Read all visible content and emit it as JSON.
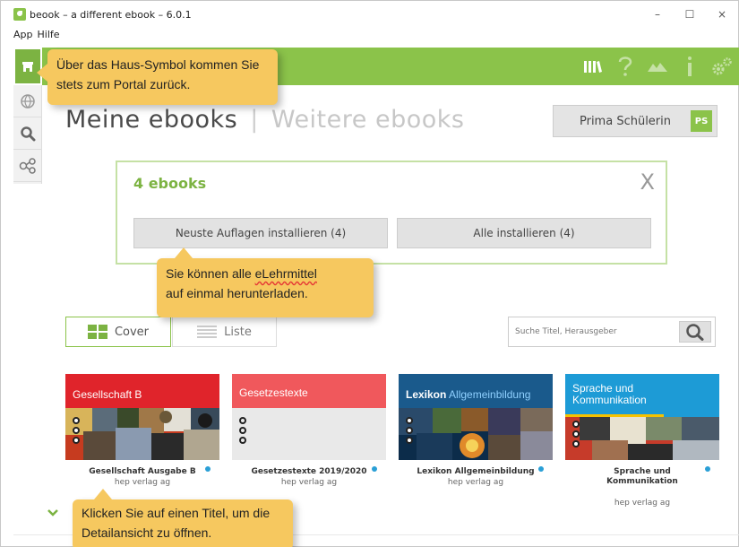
{
  "window": {
    "title": "beook – a different ebook – 6.0.1",
    "minimize": "–",
    "maximize": "☐",
    "close": "×"
  },
  "menu": [
    "App",
    "Hilfe"
  ],
  "tabs": {
    "active": "Meine ebooks",
    "separator": "|",
    "inactive": "Weitere ebooks"
  },
  "user": {
    "name": "Prima Schülerin",
    "initials": "PS"
  },
  "ebook_box": {
    "count_label": "4 ebooks",
    "close": "X",
    "install_newest": "Neuste Auflagen installieren (4)",
    "install_all": "Alle installieren (4)"
  },
  "view": {
    "cover": "Cover",
    "list": "Liste"
  },
  "search": {
    "placeholder": "Suche Titel, Herausgeber"
  },
  "books": [
    {
      "cover_title": "Gesellschaft  B",
      "title": "Gesellschaft Ausgabe B",
      "publisher": "hep verlag ag",
      "color": "#e0242b"
    },
    {
      "cover_title": "Gesetzestexte",
      "title": "Gesetzestexte 2019/2020",
      "publisher": "hep verlag ag",
      "color": "#f0585c"
    },
    {
      "cover_title": "Lexikon",
      "cover_title_2": "Allgemeinbildung",
      "title": "Lexikon Allgemeinbildung",
      "publisher": "hep verlag ag",
      "color": "#1a5a8c"
    },
    {
      "cover_title": "Sprache und Kommunikation",
      "title": "Sprache und Kommunikation",
      "publisher": "hep verlag ag",
      "color": "#1d9bd6"
    }
  ],
  "tooltips": {
    "home": "Über das Haus-Symbol kommen Sie stets zum Portal zurück.",
    "download_1": "Sie können alle ",
    "download_word": "eLehrmittel",
    "download_2": "auf einmal herunterladen.",
    "detail": "Klicken Sie auf einen Titel, um die Detailansicht zu öffnen."
  },
  "icons": [
    "home-icon",
    "library-icon",
    "help-icon",
    "landscape-icon",
    "info-icon",
    "settings-icon",
    "globe-icon",
    "search-icon",
    "share-icon",
    "grid-icon",
    "list-icon",
    "chevron-down-icon"
  ],
  "colors": {
    "accent": "#8bc34a",
    "tooltip": "#f6c85f"
  }
}
